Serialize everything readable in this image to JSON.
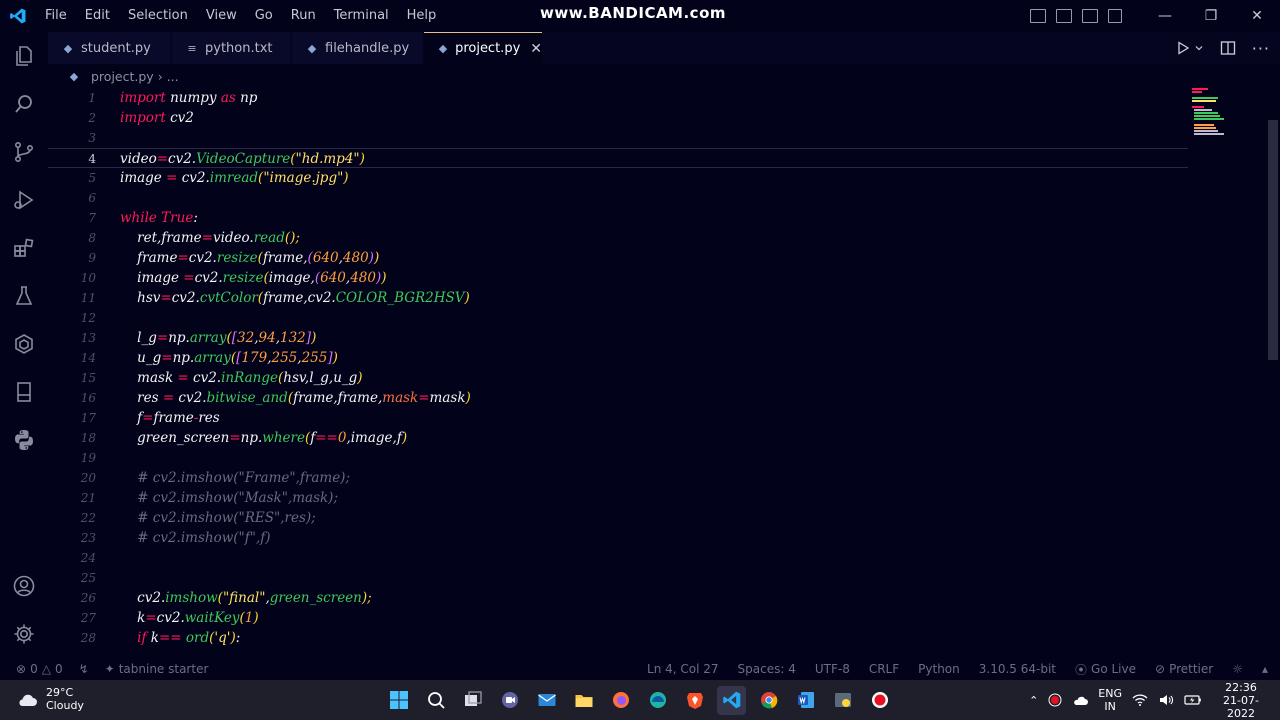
{
  "titlebar": {
    "menu": [
      "File",
      "Edit",
      "Selection",
      "View",
      "Go",
      "Run",
      "Terminal",
      "Help"
    ],
    "watermark": "www.BANDICAM.com"
  },
  "tabs": [
    {
      "label": "student.py"
    },
    {
      "label": "python.txt"
    },
    {
      "label": "filehandle.py"
    },
    {
      "label": "project.py",
      "active": true
    }
  ],
  "breadcrumb": {
    "file": "project.py",
    "more": "..."
  },
  "editor": {
    "current_line": 4,
    "lines": [
      {
        "n": "1"
      },
      {
        "n": "2"
      },
      {
        "n": "3"
      },
      {
        "n": "4"
      },
      {
        "n": "5"
      },
      {
        "n": "6"
      },
      {
        "n": "7"
      },
      {
        "n": "8"
      },
      {
        "n": "9"
      },
      {
        "n": "10"
      },
      {
        "n": "11"
      },
      {
        "n": "12"
      },
      {
        "n": "13"
      },
      {
        "n": "14"
      },
      {
        "n": "15"
      },
      {
        "n": "16"
      },
      {
        "n": "17"
      },
      {
        "n": "18"
      },
      {
        "n": "19"
      },
      {
        "n": "20"
      },
      {
        "n": "21"
      },
      {
        "n": "22"
      },
      {
        "n": "23"
      },
      {
        "n": "24"
      },
      {
        "n": "25"
      },
      {
        "n": "26"
      },
      {
        "n": "27"
      },
      {
        "n": "28"
      }
    ]
  },
  "statusbar": {
    "errors": "0",
    "warnings": "0",
    "tabnine": "tabnine starter",
    "position": "Ln 4, Col 27",
    "spaces": "Spaces: 4",
    "encoding": "UTF-8",
    "eol": "CRLF",
    "language": "Python",
    "interpreter": "3.10.5 64-bit",
    "golive": "Go Live",
    "prettier": "Prettier"
  },
  "taskbar": {
    "temperature": "29°C",
    "weather": "Cloudy",
    "lang1": "ENG",
    "lang2": "IN",
    "time": "22:36",
    "date": "21-07-2022"
  },
  "colors": {
    "background": "#02021a",
    "keyword": "#ff1a5a",
    "function": "#3fc95b",
    "string": "#ffe066",
    "number": "#ff9f43",
    "comment": "#6a6a80"
  }
}
